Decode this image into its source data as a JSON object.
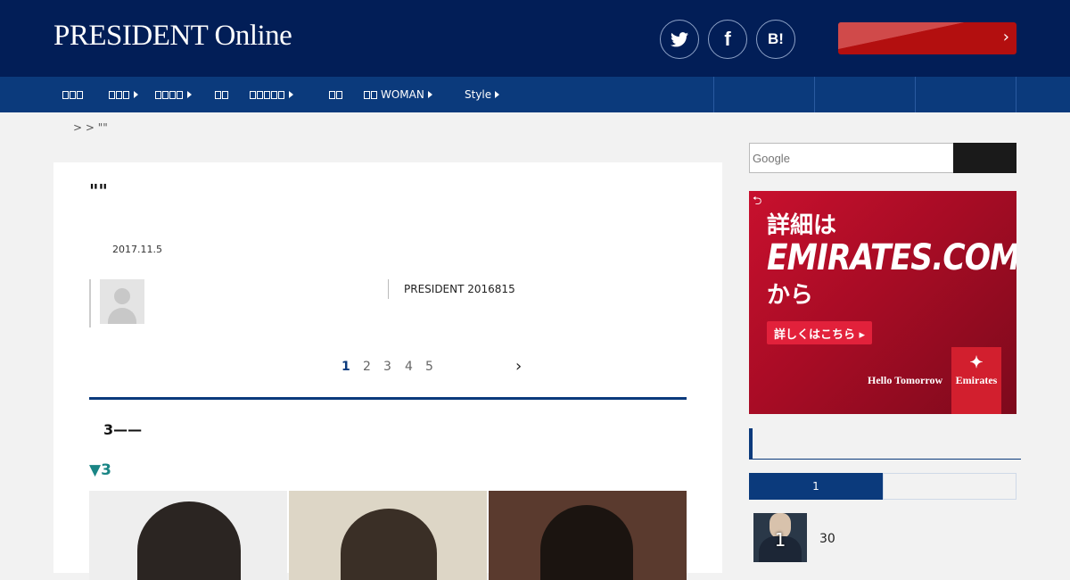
{
  "header": {
    "logo": "PRESIDENT Online",
    "social": {
      "twitter": "twitter-icon",
      "facebook": "f",
      "hatena": "B!"
    },
    "cta_arrow": "›"
  },
  "nav": {
    "items": [
      {
        "label": "",
        "boxes": 3,
        "arrow": true
      },
      {
        "label": "",
        "boxes": 3,
        "arrow": true
      },
      {
        "label": "",
        "boxes": 4,
        "arrow": true
      },
      {
        "label": "",
        "boxes": 2,
        "arrow": false
      },
      {
        "label": "",
        "boxes": 4,
        "arrow": true
      },
      {
        "label": "",
        "boxes": 2,
        "arrow": false
      },
      {
        "label": "WOMAN",
        "boxes": 2,
        "arrow": true
      },
      {
        "label": "Style",
        "boxes": 0,
        "arrow": true
      }
    ]
  },
  "breadcrumb": {
    "text": ">        > \"\""
  },
  "article": {
    "title": "\"\"",
    "date": "2017.11.5",
    "source": "PRESIDENT 2016815",
    "pagination": {
      "pages": [
        "1",
        "2",
        "3",
        "4",
        "5"
      ],
      "current": "1",
      "next": "›"
    },
    "subhead": "3——",
    "section_title": "▼3"
  },
  "sidebar": {
    "search": {
      "placeholder": "Google"
    },
    "ad": {
      "back": "⮌",
      "line1": "詳細は",
      "line2": "EMIRATES.COM",
      "line3": "から",
      "button": "詳しくはこちら ▸",
      "tagline": "Hello Tomorrow",
      "brand": "Emirates",
      "brand_glyph": "✦"
    },
    "ranking": {
      "tab_active": "1",
      "tab_inactive": "",
      "first_item": {
        "rank": "1",
        "text": "30"
      }
    }
  },
  "colors": {
    "header": "#021e57",
    "nav": "#0b3a7c",
    "accent_red": "#b30f0f",
    "section_teal": "#1a8585"
  }
}
